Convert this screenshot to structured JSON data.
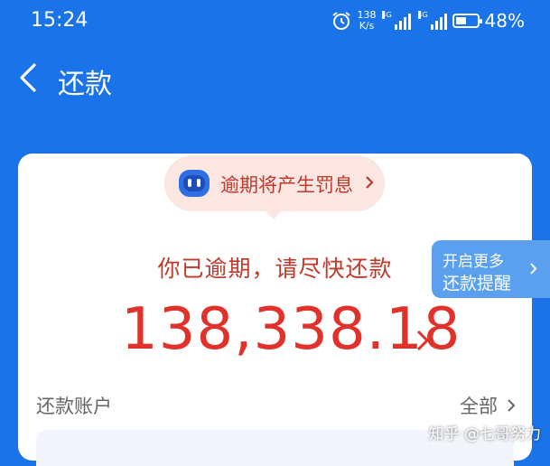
{
  "status_bar": {
    "time": "15:24",
    "net_speed_value": "138",
    "net_speed_unit": "K/s",
    "signal_label": "4G",
    "battery_percent": 48,
    "battery_text": "48%",
    "icons": [
      "alarm-icon",
      "signal-icon",
      "battery-icon"
    ]
  },
  "nav": {
    "back_icon": "chevron-left-icon",
    "title": "还款"
  },
  "warning": {
    "icon": "robot-icon",
    "text": "逾期将产生罚息"
  },
  "overdue_message": "你已逾期，请尽快还款",
  "amount": "138,338.18",
  "account_section": {
    "label": "还款账户",
    "all_label": "全部"
  },
  "reminder_tab": {
    "line1": "开启更多",
    "line2": "还款提醒"
  },
  "watermark": "知乎 @七哥努力",
  "colors": {
    "primary": "#1a73e8",
    "danger": "#e0322b",
    "warn_bg": "#fbe6e1",
    "reminder_bg": "#5aa0ee"
  }
}
